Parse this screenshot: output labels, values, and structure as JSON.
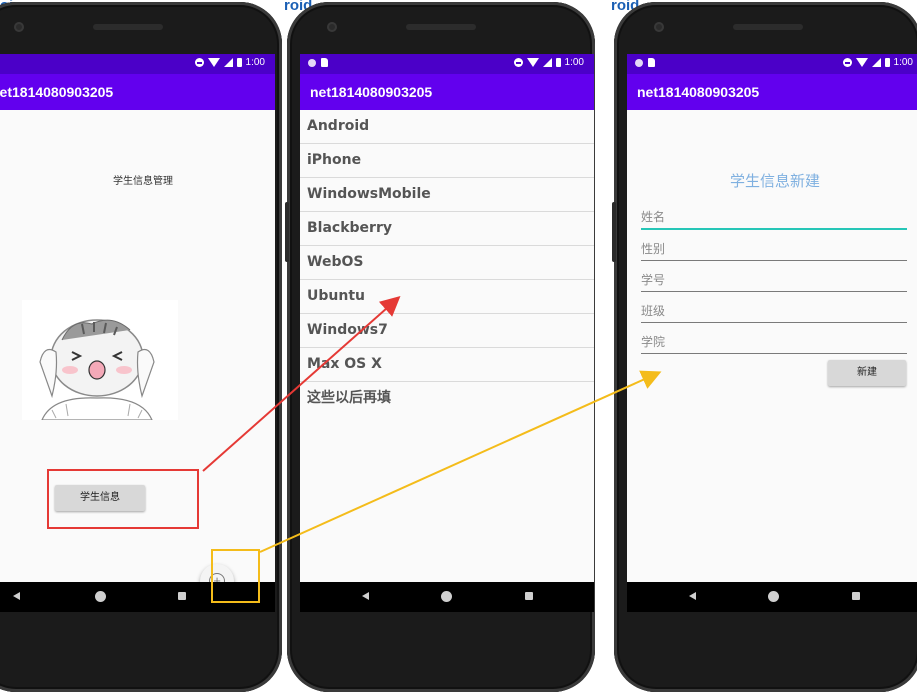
{
  "background": {
    "top_text_1": "roi",
    "top_text_2": "roid"
  },
  "status_bar": {
    "time": "1:00"
  },
  "app_title": "net1814080903205",
  "screen1": {
    "title": "学生信息管理",
    "image": "hamster-illustration",
    "student_info_button": "学生信息",
    "fab_icon": "add-circle-icon"
  },
  "screen2": {
    "items": [
      "Android",
      "iPhone",
      "WindowsMobile",
      "Blackberry",
      "WebOS",
      "Ubuntu",
      "Windows7",
      "Max OS X",
      "这些以后再填"
    ]
  },
  "screen3": {
    "title": "学生信息新建",
    "fields": [
      {
        "placeholder": "姓名"
      },
      {
        "placeholder": "性别"
      },
      {
        "placeholder": "学号"
      },
      {
        "placeholder": "班级"
      },
      {
        "placeholder": "学院"
      }
    ],
    "create_button": "新建"
  },
  "colors": {
    "status_bar": "#4b00c8",
    "app_bar": "#6200ee",
    "highlight_red": "#e53935",
    "highlight_yellow": "#f4bc1a",
    "title_blue": "#7fb0e0",
    "focus_teal": "#26c6b7"
  }
}
